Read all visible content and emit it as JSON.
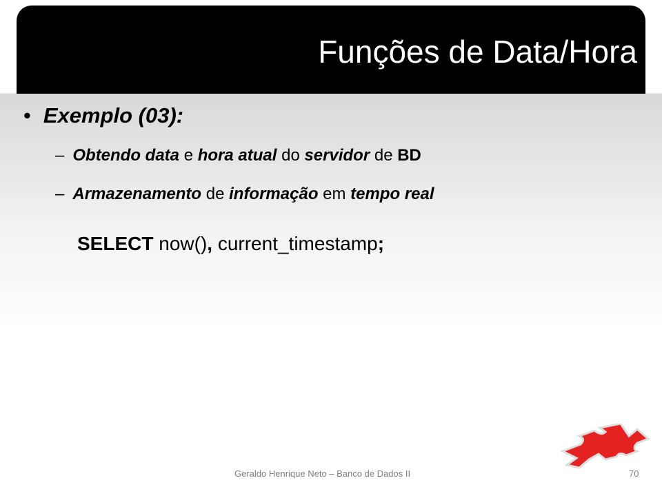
{
  "title": "Funções de Data/Hora",
  "bullet": {
    "label": "Exemplo (03):"
  },
  "sub1": {
    "dash": "–",
    "p1": "Obtendo data",
    "p2": " e ",
    "p3": "hora atual",
    "p4": " do ",
    "p5": "servidor",
    "p6": " de ",
    "p7": "BD"
  },
  "sub2": {
    "dash": "–",
    "p1": "Armazenamento",
    "p2": " de ",
    "p3": "informação",
    "p4": " em ",
    "p5": "tempo real"
  },
  "sql": {
    "kw": "SELECT",
    "f1": " now()",
    "comma": ",",
    "f2": " current_timestamp",
    "semi": ";"
  },
  "footer": "Geraldo Henrique Neto – Banco de Dados II",
  "page_number": "70",
  "colors": {
    "logo": "#e52222",
    "titlebar": "#000000"
  }
}
